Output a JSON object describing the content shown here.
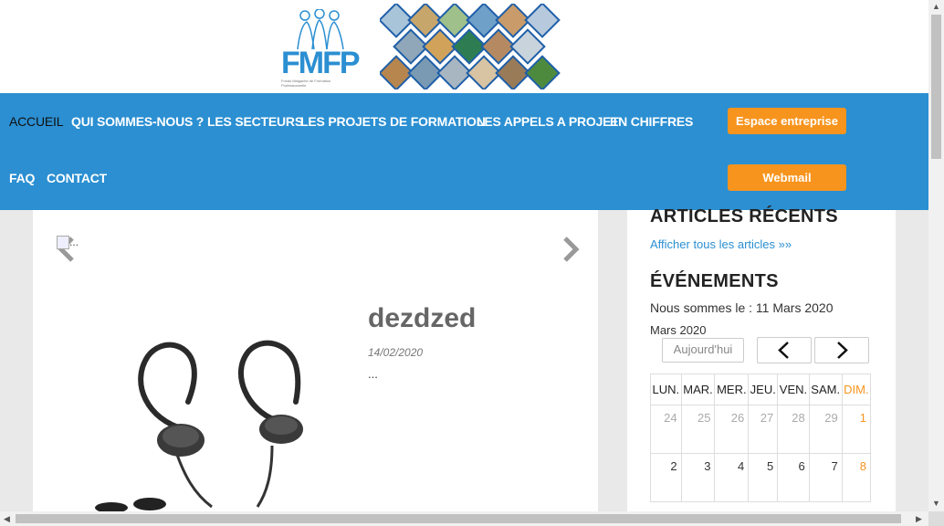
{
  "header": {
    "logo_text": "FMFP",
    "logo_subtitle": "Fonds Malgache de Formation Professionnelle"
  },
  "nav": {
    "items": [
      {
        "label": "ACCUEIL"
      },
      {
        "label": "QUI SOMMES-NOUS ?"
      },
      {
        "label": "LES SECTEURS"
      },
      {
        "label": "LES PROJETS DE FORMATION"
      },
      {
        "label": "LES APPELS A PROJET"
      },
      {
        "label": "EN CHIFFRES"
      },
      {
        "label": "FAQ"
      },
      {
        "label": "CONTACT"
      }
    ],
    "btn_entreprise": "Espace entreprise",
    "btn_webmail": "Webmail"
  },
  "article": {
    "img_alt": "...",
    "title": "dezdzed",
    "date": "14/02/2020",
    "excerpt": "..."
  },
  "sidebar": {
    "recent_title": "ARTICLES RÉCENTS",
    "all_articles": "Afficher tous les articles »»",
    "events_title": "ÉVÉNEMENTS",
    "today_text": "Nous sommes le : 11 Mars 2020",
    "month": "Mars 2020",
    "today_button": "Aujourd'hui",
    "weekdays": [
      "LUN.",
      "MAR.",
      "MER.",
      "JEU.",
      "VEN.",
      "SAM.",
      "DIM."
    ],
    "weeks": [
      [
        "24",
        "25",
        "26",
        "27",
        "28",
        "29",
        "1"
      ],
      [
        "2",
        "3",
        "4",
        "5",
        "6",
        "7",
        "8"
      ]
    ]
  },
  "colors": {
    "brand_blue": "#2b8fd2",
    "orange": "#f7941d"
  }
}
